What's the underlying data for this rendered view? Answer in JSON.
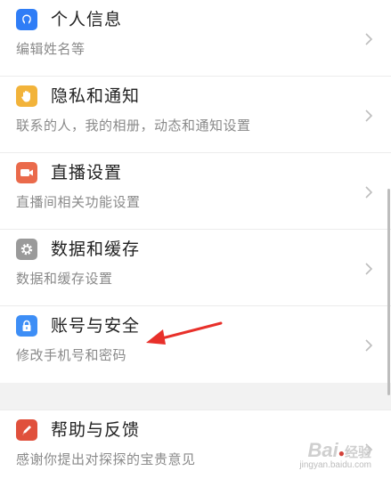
{
  "settings": {
    "items": [
      {
        "title": "个人信息",
        "subtitle": "编辑姓名等",
        "icon": "user-profile-icon",
        "color": "#2f7df6"
      },
      {
        "title": "隐私和通知",
        "subtitle": "联系的人，我的相册，动态和通知设置",
        "icon": "hand-icon",
        "color": "#f2b33a"
      },
      {
        "title": "直播设置",
        "subtitle": "直播间相关功能设置",
        "icon": "video-camera-icon",
        "color": "#ea6a4b"
      },
      {
        "title": "数据和缓存",
        "subtitle": "数据和缓存设置",
        "icon": "gear-icon",
        "color": "#9a9a9a"
      },
      {
        "title": "账号与安全",
        "subtitle": "修改手机号和密码",
        "icon": "lock-icon",
        "color": "#3d8ef6"
      }
    ],
    "help": {
      "title": "帮助与反馈",
      "subtitle": "感谢你提出对探探的宝贵意见",
      "icon": "pencil-icon",
      "color": "#e0503c"
    }
  },
  "annotation": {
    "arrow_color": "#e8302a"
  },
  "watermark": {
    "logo": "Bai",
    "logo_suffix": "经验",
    "url": "jingyan.baidu.com"
  }
}
